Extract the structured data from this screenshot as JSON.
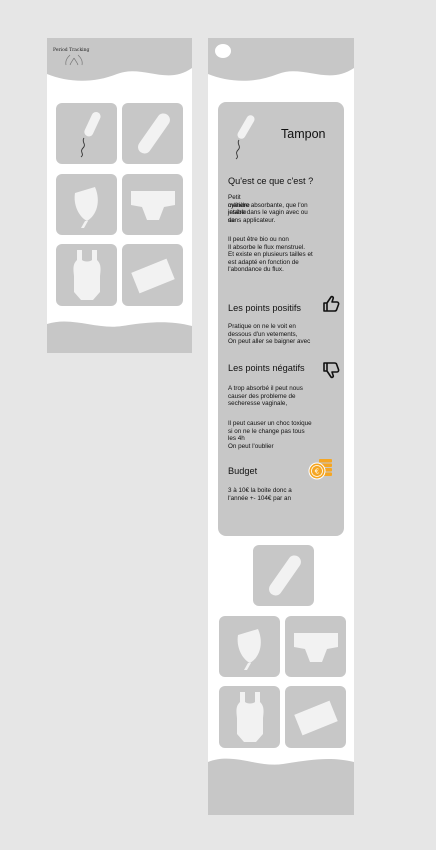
{
  "left_screen": {
    "logo_text": "Period Tracking"
  },
  "right_screen": {
    "card": {
      "title": "Tampon",
      "section_what": {
        "heading": "Qu'est ce que c'est ?",
        "para1": [
          "Petit cylindre jetable de",
          "matière absorbante, que l'on",
          "insère dans le vagin avec ou",
          "sans applicateur."
        ],
        "para2": [
          "Il peut être bio ou non",
          "Il absorbe le flux menstruel.",
          "Et existe en plusieurs tailles et",
          "est adapté en fonction de",
          "l'abondance du flux."
        ]
      },
      "section_positive": {
        "heading": "Les points positifs",
        "lines": [
          "Pratique on ne le voit en",
          "dessous d'un vetements,",
          "On peut aller se baigner avec"
        ]
      },
      "section_negative": {
        "heading": "Les points négatifs",
        "para1": [
          "A trop absorbé il peut nous",
          "causer des probleme de",
          "secheresse vaginale,"
        ],
        "para2": [
          "Il peut causer un choc toxique",
          "si on ne le change pas tous",
          "les 4h",
          "On peut l'oublier"
        ]
      },
      "section_budget": {
        "heading": "Budget",
        "lines": [
          "3 à 10€ la boite donc a",
          "l'année +- 104€ par an"
        ]
      }
    }
  },
  "icons": {
    "tampon": "tampon-icon",
    "pad": "pad-icon",
    "cup": "menstrual-cup-icon",
    "underwear": "period-underwear-icon",
    "bodysuit": "bodysuit-icon",
    "cloth": "cloth-pad-icon",
    "thumbs_up": "thumbs-up-icon",
    "thumbs_down": "thumbs-down-icon",
    "coins": "coins-icon"
  },
  "colors": {
    "background": "#e6e6e6",
    "frame": "#ffffff",
    "tile": "#c7c7c7",
    "icon": "#f2f2f2",
    "coin": "#f5a623"
  }
}
